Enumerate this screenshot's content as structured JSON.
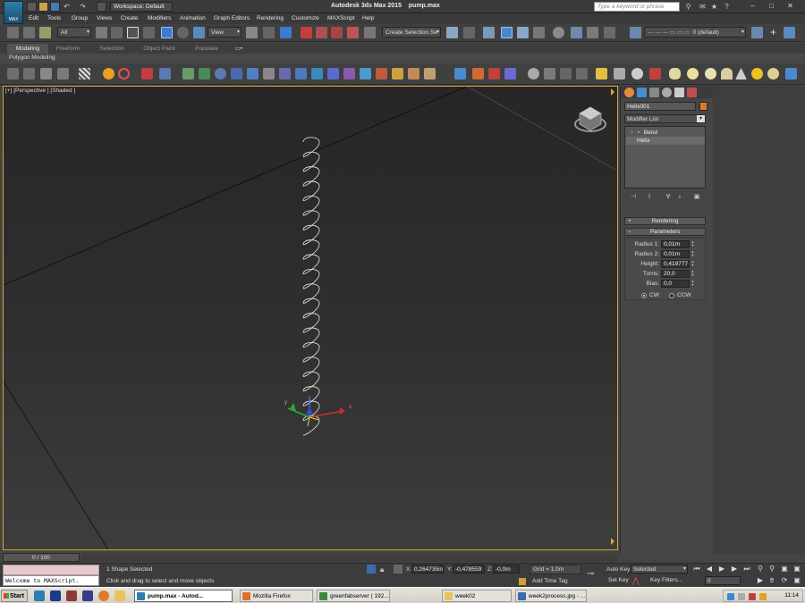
{
  "app": {
    "icon_label": "MAX",
    "title": "Autodesk 3ds Max 2015",
    "file": "pump.max",
    "workspace": "Workspace: Default",
    "search_placeholder": "Type a keyword or phrase"
  },
  "menu": [
    "Edit",
    "Tools",
    "Group",
    "Views",
    "Create",
    "Modifiers",
    "Animation",
    "Graph Editors",
    "Rendering",
    "Customize",
    "MAXScript",
    "Help"
  ],
  "toolbar": {
    "selection_filter": "All",
    "ref_coord": "View",
    "named_selection": "Create Selection Se",
    "layer": "0 (default)"
  },
  "ribbon": {
    "tabs": [
      "Modeling",
      "Freeform",
      "Selection",
      "Object Paint",
      "Populate"
    ],
    "active_tab": "Modeling",
    "panel": "Polygon Modeling"
  },
  "viewport": {
    "label": "[+] [Perspective ] [Shaded ]"
  },
  "command_panel": {
    "object_name": "Helix001",
    "object_color": "#e07a2a",
    "modifier_list": "Modifier List",
    "stack": [
      {
        "label": "Bend"
      },
      {
        "label": "Helix"
      }
    ],
    "rollouts": {
      "rendering": "Rendering",
      "parameters": "Parameters"
    },
    "parameters": [
      {
        "label": "Radius 1:",
        "value": "0,01m"
      },
      {
        "label": "Radius 2:",
        "value": "0,01m"
      },
      {
        "label": "Height:",
        "value": "0,419777"
      },
      {
        "label": "Turns:",
        "value": "20,0"
      },
      {
        "label": "Bias:",
        "value": "0,0"
      }
    ],
    "direction": {
      "cw": "CW",
      "ccw": "CCW",
      "selected": "CW"
    }
  },
  "time_slider": "0 / 100",
  "status": {
    "maxscript": "Welcome to MAXScript.",
    "selection": "1 Shape Selected",
    "prompt": "Click and drag to select and move objects",
    "x_label": "X:",
    "x_value": "0,264735m",
    "y_label": "Y:",
    "y_value": "-0,478559",
    "z_label": "Z:",
    "z_value": "-0,0m",
    "grid": "Grid = 1,0m",
    "add_time_tag": "Add Time Tag",
    "auto_key": "Auto Key",
    "set_key": "Set Key",
    "key_mode": "Selected",
    "key_filters": "Key Filters...",
    "frame": "0"
  },
  "taskbar": {
    "start": "Start",
    "tasks": [
      {
        "label": "pump.max - Autod...",
        "active": true,
        "color": "#2a7fb0"
      },
      {
        "label": "Mozilla Firefox",
        "active": false,
        "color": "#e0702a"
      },
      {
        "label": "greenfabserver ( 192...",
        "active": false,
        "color": "#3a8a3a"
      },
      {
        "label": "week02",
        "active": false,
        "color": "#e8c35a"
      },
      {
        "label": "week2process.jpg - ...",
        "active": false,
        "color": "#3a6ab0"
      }
    ],
    "clock": "11:14"
  }
}
